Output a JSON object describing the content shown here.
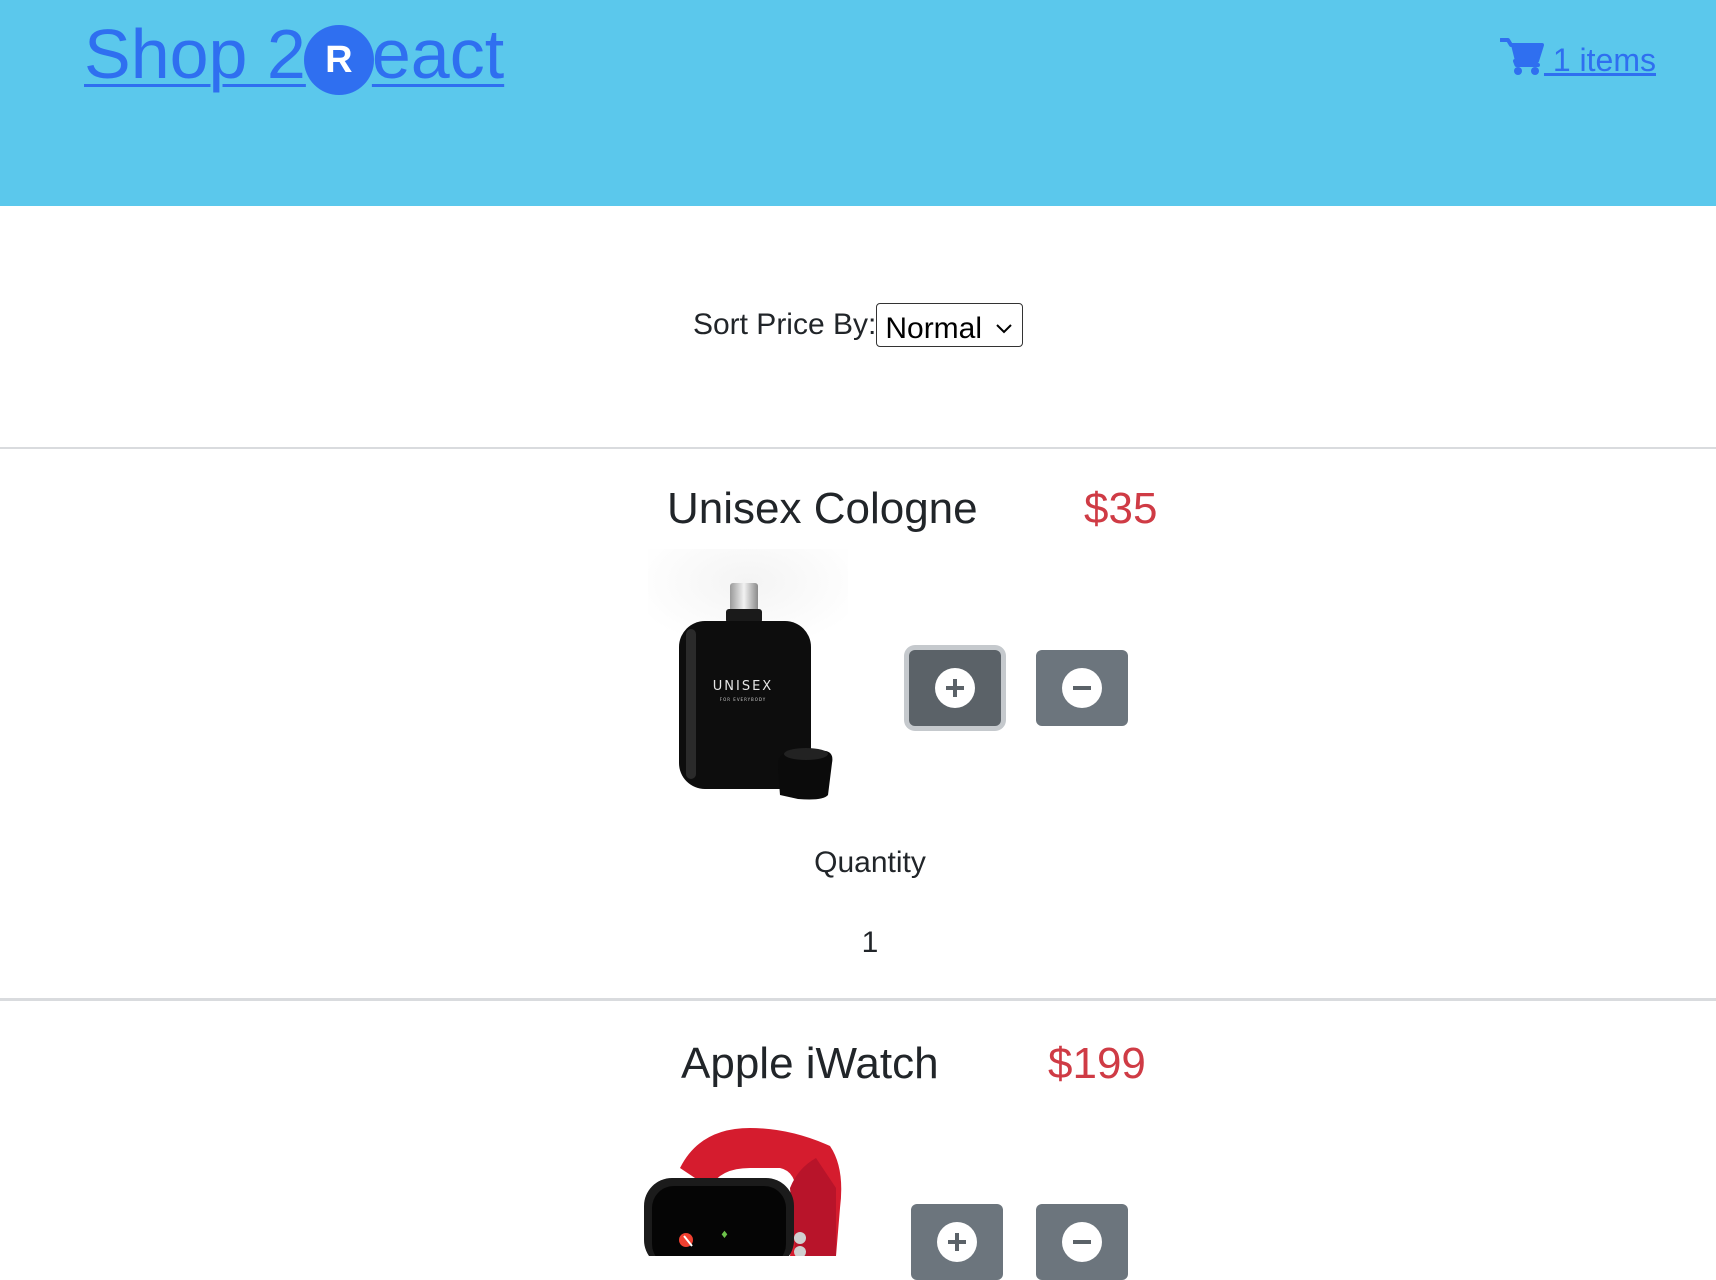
{
  "header": {
    "brand_prefix": "Shop 2",
    "brand_logo_letter": "R",
    "brand_suffix": "eact",
    "cart_label": " 1 items",
    "background": "#5bc8ec",
    "link_color": "#2f6ff0"
  },
  "sort": {
    "label": "Sort Price By:",
    "selected": "Normal"
  },
  "products": [
    {
      "name": "Unisex Cologne",
      "price": "$35",
      "image_label": "UNISEX",
      "image_sublabel": "FOR EVERYBODY",
      "quantity_label": "Quantity",
      "quantity": "1",
      "plus_icon": "plus-circle-icon",
      "minus_icon": "minus-circle-icon"
    },
    {
      "name": "Apple iWatch",
      "price": "$199",
      "plus_icon": "plus-circle-icon",
      "minus_icon": "minus-circle-icon"
    }
  ],
  "colors": {
    "price": "#cf3b45",
    "button": "#6c757d"
  }
}
